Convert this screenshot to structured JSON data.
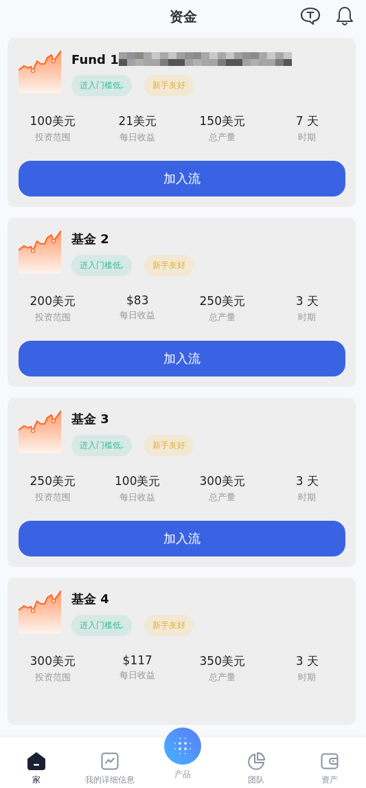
{
  "header": {
    "title": "资金"
  },
  "funds": [
    {
      "name": "Fund 1",
      "name_obscured": true,
      "tags": [
        {
          "text": "进入门槛低,",
          "kind": "entry"
        },
        {
          "text": "新手友好",
          "kind": "beginner"
        }
      ],
      "stats": [
        {
          "value": "100美元",
          "label": "投资范围"
        },
        {
          "value": "21美元",
          "label": "每日收益"
        },
        {
          "value": "150美元",
          "label": "总产量"
        },
        {
          "value": "7 天",
          "label": "时期"
        }
      ],
      "button": "加入流"
    },
    {
      "name": "基金 2",
      "name_obscured": false,
      "tags": [
        {
          "text": "进入门槛低,",
          "kind": "entry"
        },
        {
          "text": "新手友好",
          "kind": "beginner"
        }
      ],
      "stats": [
        {
          "value": "200美元",
          "label": "投资范围"
        },
        {
          "value": "$83",
          "label": "每日收益"
        },
        {
          "value": "250美元",
          "label": "总产量"
        },
        {
          "value": "3 天",
          "label": "时期"
        }
      ],
      "button": "加入流"
    },
    {
      "name": "基金 3",
      "name_obscured": false,
      "tags": [
        {
          "text": "进入门槛低,",
          "kind": "entry"
        },
        {
          "text": "新手友好",
          "kind": "beginner"
        }
      ],
      "stats": [
        {
          "value": "250美元",
          "label": "投资范围"
        },
        {
          "value": "100美元",
          "label": "每日收益"
        },
        {
          "value": "300美元",
          "label": "总产量"
        },
        {
          "value": "3 天",
          "label": "时期"
        }
      ],
      "button": "加入流"
    },
    {
      "name": "基金 4",
      "name_obscured": false,
      "tags": [
        {
          "text": "进入门槛低,",
          "kind": "entry"
        },
        {
          "text": "新手友好",
          "kind": "beginner"
        }
      ],
      "stats": [
        {
          "value": "300美元",
          "label": "投资范围"
        },
        {
          "value": "$117",
          "label": "每日收益"
        },
        {
          "value": "350美元",
          "label": "总产量"
        },
        {
          "value": "3 天",
          "label": "时期"
        }
      ]
    }
  ],
  "nav": [
    {
      "label": "家",
      "kind": "home",
      "selected": true
    },
    {
      "label": "我的详细信息",
      "kind": "details",
      "selected": false
    },
    {
      "label": "产品",
      "kind": "center",
      "selected": false
    },
    {
      "label": "团队",
      "kind": "team",
      "selected": false
    },
    {
      "label": "资产",
      "kind": "assets",
      "selected": false
    }
  ]
}
